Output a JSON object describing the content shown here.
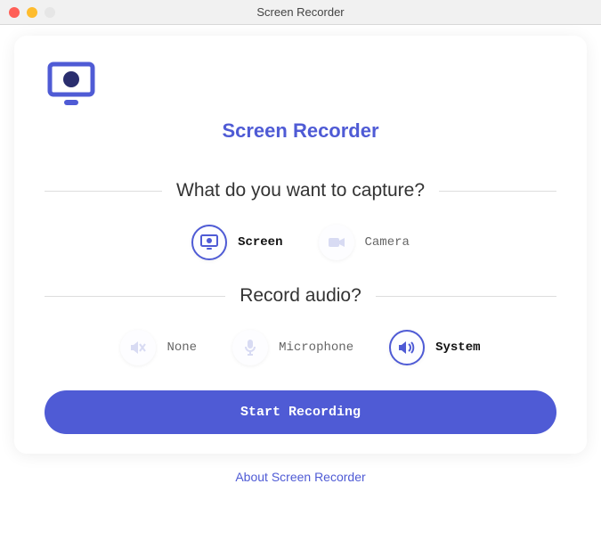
{
  "window": {
    "title": "Screen Recorder"
  },
  "app": {
    "heading": "Screen Recorder"
  },
  "capture": {
    "heading": "What do you want to capture?",
    "options": [
      {
        "label": "Screen",
        "icon": "screen-icon",
        "selected": true
      },
      {
        "label": "Camera",
        "icon": "camera-icon",
        "selected": false
      }
    ]
  },
  "audio": {
    "heading": "Record audio?",
    "options": [
      {
        "label": "None",
        "icon": "mute-icon",
        "selected": false
      },
      {
        "label": "Microphone",
        "icon": "microphone-icon",
        "selected": false
      },
      {
        "label": "System",
        "icon": "speaker-icon",
        "selected": true
      }
    ]
  },
  "actions": {
    "start_label": "Start Recording",
    "about_label": "About Screen Recorder"
  },
  "colors": {
    "accent": "#4f5bd5"
  }
}
